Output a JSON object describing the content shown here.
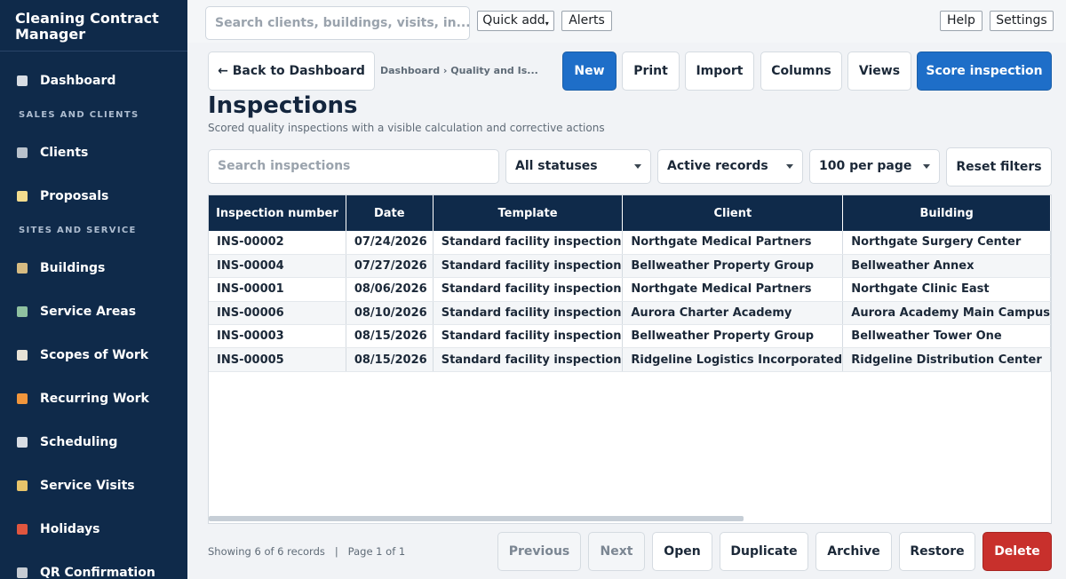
{
  "app": {
    "title": "Cleaning Contract Manager"
  },
  "sidebar": {
    "sections": [
      "SALES AND CLIENTS",
      "SITES AND SERVICE"
    ],
    "items": [
      {
        "label": "Dashboard",
        "icon": "bar-chart-icon",
        "color": "#d8dde4"
      },
      {
        "label": "Clients",
        "icon": "office-building-icon",
        "color": "#b9c2cc"
      },
      {
        "label": "Proposals",
        "icon": "memo-icon",
        "color": "#f2dc8e"
      },
      {
        "label": "Buildings",
        "icon": "house-building-icon",
        "color": "#d6bb82"
      },
      {
        "label": "Service Areas",
        "icon": "map-icon",
        "color": "#8fc1a0"
      },
      {
        "label": "Scopes of Work",
        "icon": "clipboard-icon",
        "color": "#e7e2d6"
      },
      {
        "label": "Recurring Work",
        "icon": "repeat-icon",
        "color": "#f1963c"
      },
      {
        "label": "Scheduling",
        "icon": "calendar-icon",
        "color": "#d8dde4"
      },
      {
        "label": "Service Visits",
        "icon": "broom-icon",
        "color": "#e8c46a"
      },
      {
        "label": "Holidays",
        "icon": "date-icon",
        "color": "#e0563f"
      },
      {
        "label": "QR Confirmation",
        "icon": "qr-code-icon",
        "color": "#c6ccd3"
      }
    ]
  },
  "topbar": {
    "search_placeholder": "Search clients, buildings, visits, in...",
    "quick_add": "Quick add",
    "alerts": "Alerts",
    "help": "Help",
    "settings": "Settings"
  },
  "toolbar": {
    "back": "← Back to Dashboard",
    "breadcrumb": "Dashboard › Quality and Is...",
    "new": "New",
    "print": "Print",
    "import": "Import",
    "columns": "Columns",
    "views": "Views",
    "score": "Score inspection"
  },
  "page": {
    "title": "Inspections",
    "subtitle": "Scored quality inspections with a visible calculation and corrective actions"
  },
  "filters": {
    "search_placeholder": "Search inspections",
    "status": "All statuses",
    "records": "Active records",
    "per_page": "100 per page",
    "reset": "Reset filters"
  },
  "table": {
    "headers": [
      "Inspection number",
      "Date",
      "Template",
      "Client",
      "Building"
    ],
    "rows": [
      [
        "INS-00002",
        "07/24/2026",
        "Standard facility inspection",
        "Northgate Medical Partners",
        "Northgate Surgery Center"
      ],
      [
        "INS-00004",
        "07/27/2026",
        "Standard facility inspection",
        "Bellweather Property Group",
        "Bellweather Annex"
      ],
      [
        "INS-00001",
        "08/06/2026",
        "Standard facility inspection",
        "Northgate Medical Partners",
        "Northgate Clinic East"
      ],
      [
        "INS-00006",
        "08/10/2026",
        "Standard facility inspection",
        "Aurora Charter Academy",
        "Aurora Academy Main Campus"
      ],
      [
        "INS-00003",
        "08/15/2026",
        "Standard facility inspection",
        "Bellweather Property Group",
        "Bellweather Tower One"
      ],
      [
        "INS-00005",
        "08/15/2026",
        "Standard facility inspection",
        "Ridgeline Logistics Incorporated",
        "Ridgeline Distribution Center"
      ]
    ]
  },
  "footer": {
    "status": "Showing 6 of 6 records   |   Page 1 of 1",
    "previous": "Previous",
    "next": "Next",
    "open": "Open",
    "duplicate": "Duplicate",
    "archive": "Archive",
    "restore": "Restore",
    "delete": "Delete"
  }
}
